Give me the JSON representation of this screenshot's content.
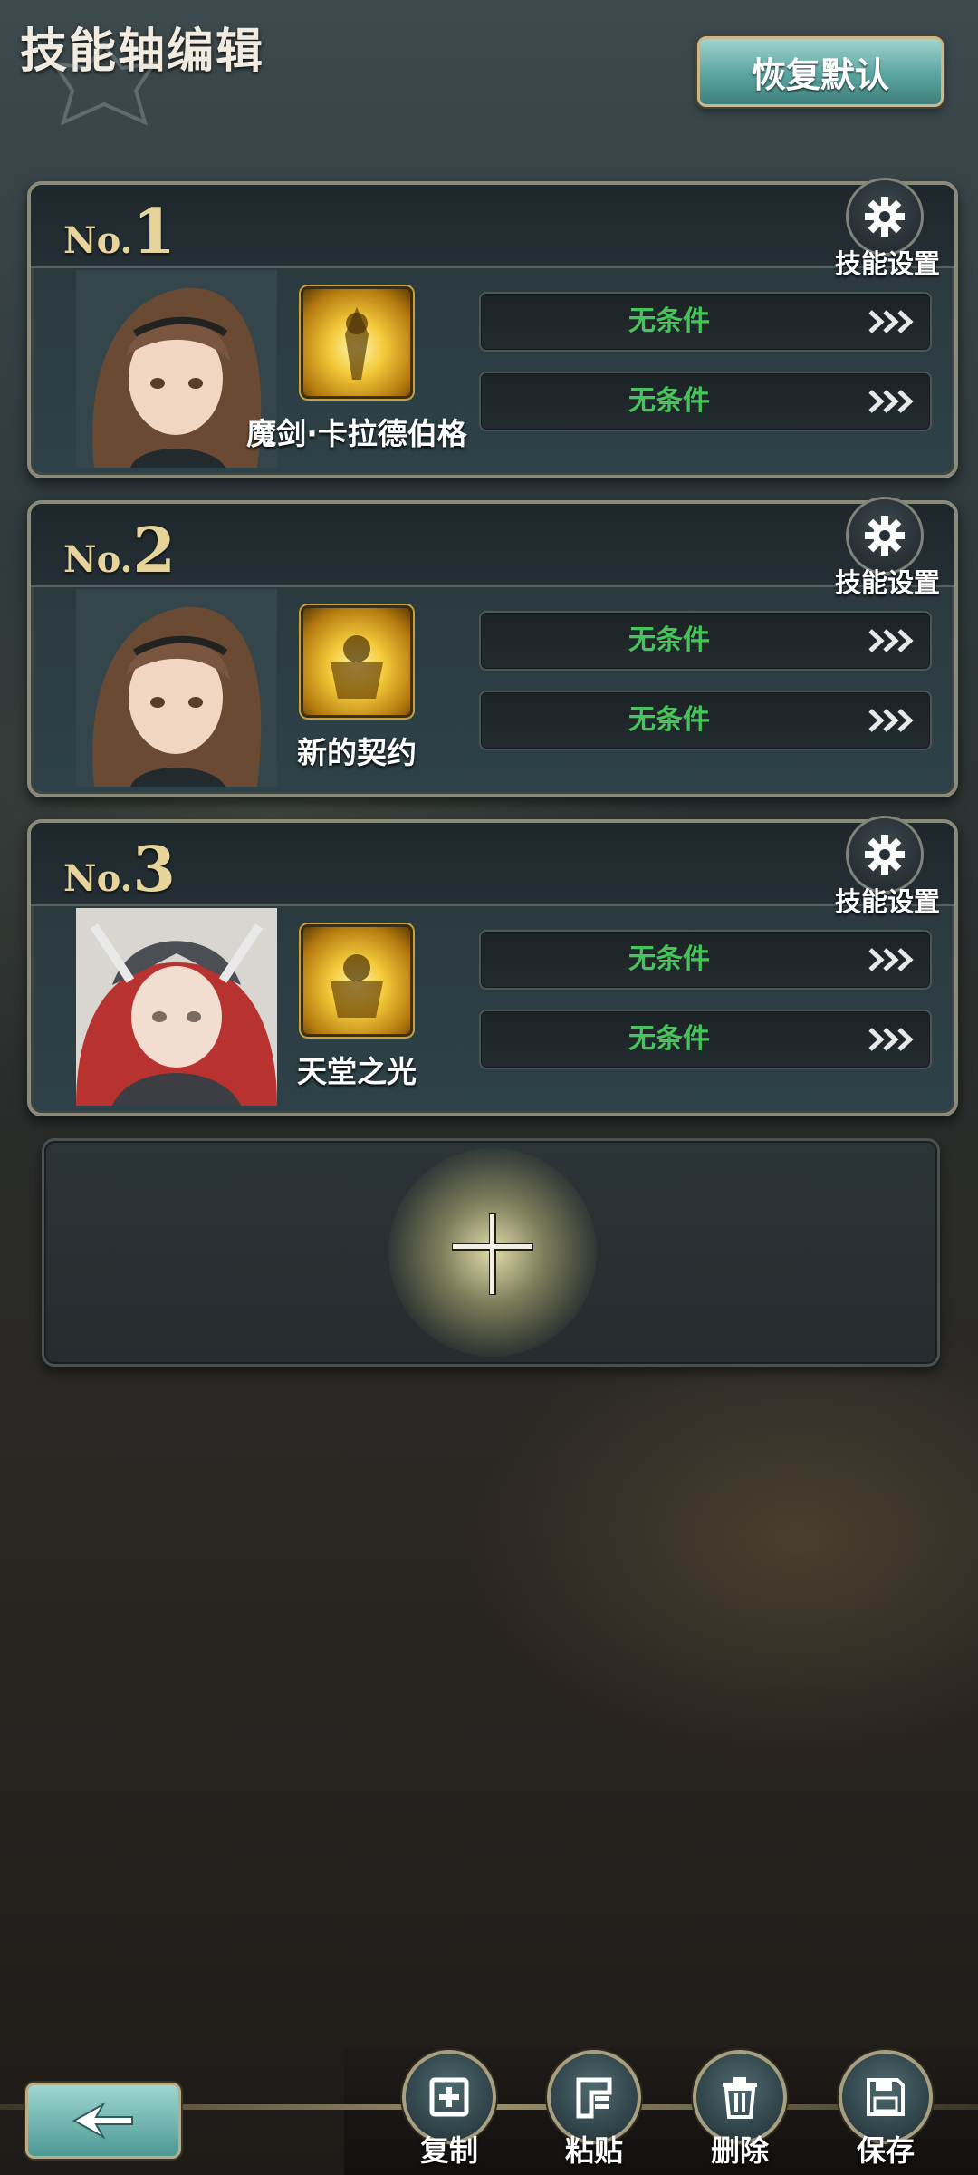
{
  "header": {
    "title": "技能轴编辑",
    "reset_label": "恢复默认"
  },
  "cards": [
    {
      "no_prefix": "No.",
      "no_number": "1",
      "settings_label": "技能设置",
      "skill_name": "魔剑·卡拉德伯格",
      "conditions": [
        "无条件",
        "无条件"
      ]
    },
    {
      "no_prefix": "No.",
      "no_number": "2",
      "settings_label": "技能设置",
      "skill_name": "新的契约",
      "conditions": [
        "无条件",
        "无条件"
      ]
    },
    {
      "no_prefix": "No.",
      "no_number": "3",
      "settings_label": "技能设置",
      "skill_name": "天堂之光",
      "conditions": [
        "无条件",
        "无条件"
      ]
    }
  ],
  "toolbar": {
    "copy_label": "复制",
    "paste_label": "粘贴",
    "delete_label": "删除",
    "save_label": "保存"
  },
  "colors": {
    "condition_text": "#46c55a",
    "number_gold": "#e6d49a",
    "reset_button": "#5aa49f"
  },
  "icons": [
    "gear-icon",
    "chevron-triple-right-icon",
    "plus-icon",
    "back-arrow-icon",
    "copy-icon",
    "paste-icon",
    "trash-icon",
    "save-icon"
  ]
}
